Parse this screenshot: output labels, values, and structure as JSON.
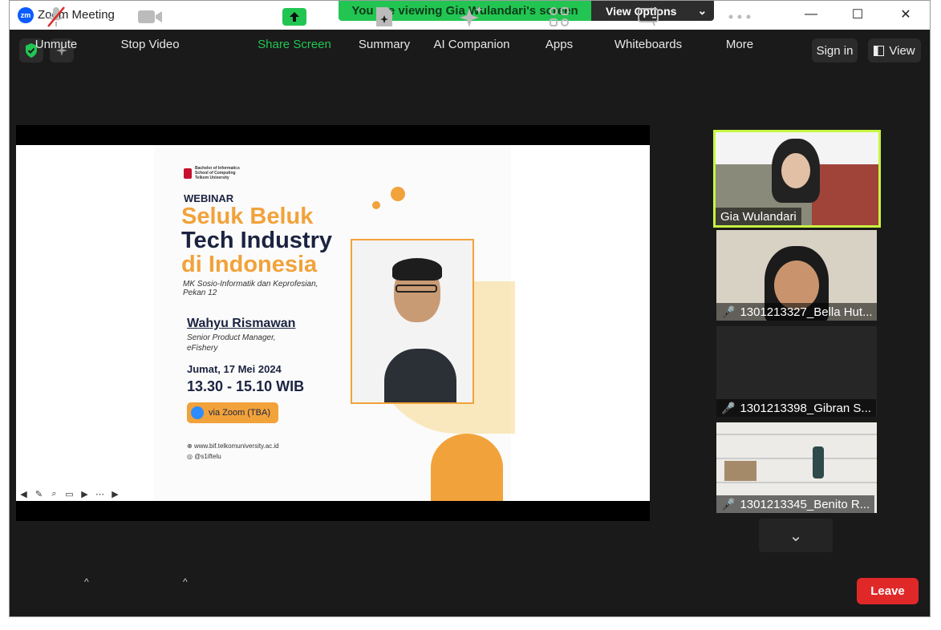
{
  "window": {
    "app_logo": "zm",
    "title": "Zoom Meeting",
    "minimize": "—",
    "maximize": "☐",
    "close": "✕"
  },
  "banner": {
    "text": "You are viewing Gia Wulandari's screen",
    "options_label": "View Options",
    "chevron": "⌄"
  },
  "topbar": {
    "sign_in": "Sign in",
    "view": "View"
  },
  "slide": {
    "org_line1": "Bachelor of Informatics",
    "org_line2": "School of Computing",
    "org_line3": "Telkom University",
    "kicker": "WEBINAR",
    "title_line1": "Seluk Beluk",
    "title_line2": "Tech Industry",
    "title_line3": "di Indonesia",
    "course": "MK Sosio-Informatik dan Keprofesian,",
    "week": "Pekan 12",
    "speaker_name": "Wahyu Rismawan",
    "speaker_role1": "Senior Product Manager,",
    "speaker_role2": "eFishery",
    "date": "Jumat, 17 Mei 2024",
    "time": "13.30 - 15.10 WIB",
    "via": "via Zoom (TBA)",
    "website": "www.bif.telkomuniversity.ac.id",
    "instagram": "@s1iftelu"
  },
  "participants": [
    {
      "name": "Gia Wulandari",
      "muted": false,
      "active_speaker": true
    },
    {
      "name": "1301213327_Bella Hut...",
      "muted": true
    },
    {
      "name": "1301213398_Gibran S...",
      "muted": true
    },
    {
      "name": "1301213345_Benito R...",
      "muted": true
    }
  ],
  "toolbar": {
    "unmute": "Unmute",
    "stop_video": "Stop Video",
    "share_screen": "Share Screen",
    "summary": "Summary",
    "ai_companion": "AI Companion",
    "apps": "Apps",
    "whiteboards": "Whiteboards",
    "more": "More",
    "leave": "Leave"
  },
  "colors": {
    "accent_green": "#23c552",
    "leave_red": "#e02828",
    "active_speaker": "#c8f542",
    "slide_orange": "#f2a23a",
    "slide_navy": "#1b2340"
  },
  "icons": {
    "shield": "shield-check-icon",
    "sparkle": "sparkle-icon",
    "view": "view-layout-icon",
    "mic": "mic-muted-icon",
    "video": "video-camera-icon",
    "share": "share-screen-icon",
    "summary": "summary-doc-icon",
    "ai": "ai-sparkle-icon",
    "apps": "apps-icon",
    "whiteboard": "whiteboard-icon",
    "more": "more-dots-icon"
  }
}
